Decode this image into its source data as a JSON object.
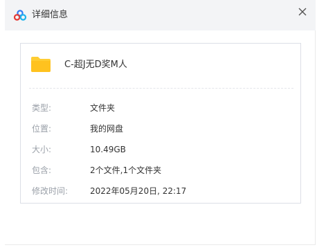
{
  "dialog": {
    "title": "详细信息",
    "close_glyph": "×",
    "app_icon": "baidu-netdisk-cloud-icon",
    "close_icon": "close-icon"
  },
  "file": {
    "icon": "folder-icon",
    "icon_color": "#FFCD33",
    "name": "C-超J无D奖M人"
  },
  "info": {
    "type_label": "类型:",
    "type_value": "文件夹",
    "location_label": "位置:",
    "location_value": "我的网盘",
    "size_label": "大小:",
    "size_value": "10.49GB",
    "contains_label": "包含:",
    "contains_value": "2个文件,1个文件夹",
    "modified_label": "修改时间:",
    "modified_value": "2022年05月20日, 22:17"
  }
}
